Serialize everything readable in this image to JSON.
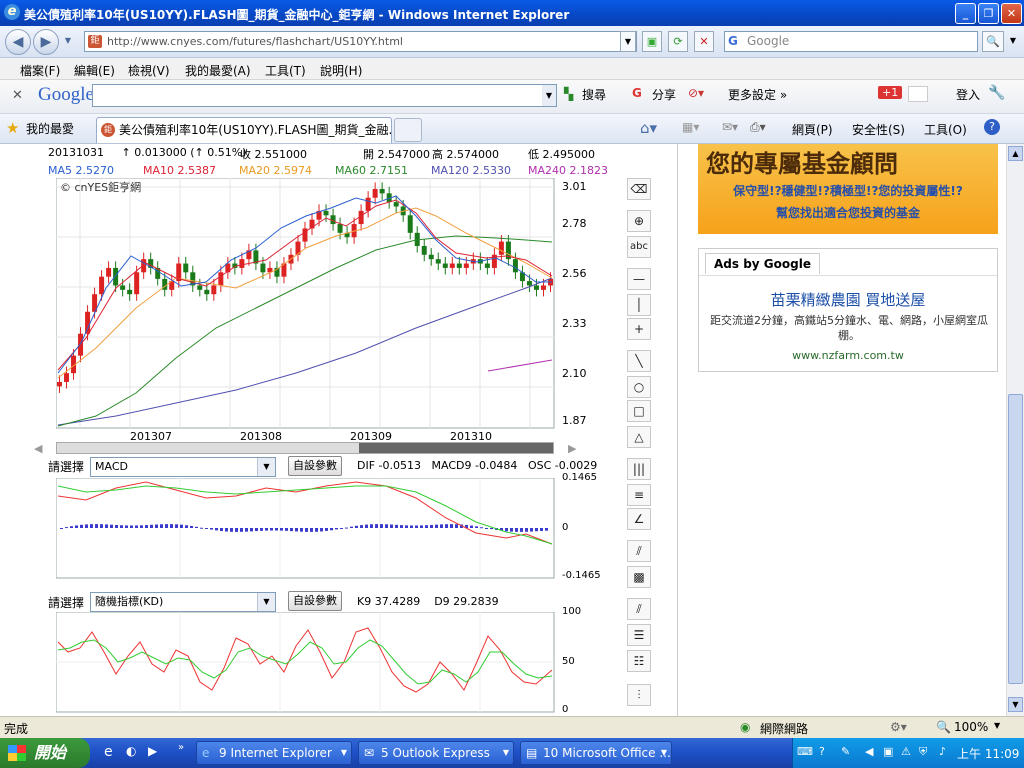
{
  "window": {
    "title": "美公債殖利率10年(US10YY).FLASH圖_期貨_金融中心_鉅亨網 - Windows Internet Explorer"
  },
  "address": {
    "url": "http://www.cnyes.com/futures/flashchart/US10YY.html",
    "search_placeholder": "Google"
  },
  "menu": [
    "檔案(F)",
    "編輯(E)",
    "檢視(V)",
    "我的最愛(A)",
    "工具(T)",
    "說明(H)"
  ],
  "google_toolbar": {
    "logo": "Google",
    "search_label": "搜尋",
    "share_label": "分享",
    "more_label": "更多設定 »",
    "gplus_label": "+1",
    "login_label": "登入"
  },
  "favorites": {
    "label": "我的最愛",
    "tab_title": "美公債殖利率10年(US10YY).FLASH圖_期貨_金融...",
    "page_label": "網頁(P)",
    "safety_label": "安全性(S)",
    "tools_label": "工具(O)"
  },
  "chart_info": {
    "date": "20131031",
    "change": "↑ 0.013000 (↑ 0.51%)",
    "close": "收 2.551000",
    "open": "開 2.547000",
    "high": "高 2.574000",
    "low": "低 2.495000",
    "ma5": "MA5 2.5270",
    "ma10": "MA10 2.5387",
    "ma20": "MA20 2.5974",
    "ma60": "MA60 2.7151",
    "ma120": "MA120 2.5330",
    "ma240": "MA240 2.1823",
    "watermark": "© cnYES鉅亨網"
  },
  "macd_panel": {
    "select_label": "請選擇",
    "selected": "MACD",
    "param_button": "自設參數",
    "dif": "DIF -0.0513",
    "macd9": "MACD9 -0.0484",
    "osc": "OSC -0.0029",
    "ymax": "0.1465",
    "yzero": "0",
    "ymin": "-0.1465"
  },
  "kd_panel": {
    "select_label": "請選擇",
    "selected": "隨機指標(KD)",
    "param_button": "自設參數",
    "k9": "K9 37.4289",
    "d9": "D9 29.2839",
    "y100": "100",
    "y50": "50",
    "y0": "0"
  },
  "chart_data": {
    "type": "candlestick",
    "x_labels": [
      "201307",
      "201308",
      "201309",
      "201310"
    ],
    "y_ticks": [
      3.01,
      2.78,
      2.56,
      2.33,
      2.1,
      1.87
    ],
    "ylim": [
      1.87,
      3.01
    ],
    "close": [
      2.08,
      2.12,
      2.2,
      2.3,
      2.4,
      2.48,
      2.56,
      2.6,
      2.52,
      2.5,
      2.48,
      2.58,
      2.64,
      2.6,
      2.55,
      2.5,
      2.54,
      2.62,
      2.58,
      2.52,
      2.5,
      2.48,
      2.52,
      2.58,
      2.62,
      2.6,
      2.64,
      2.68,
      2.62,
      2.58,
      2.6,
      2.56,
      2.62,
      2.66,
      2.72,
      2.78,
      2.82,
      2.86,
      2.84,
      2.8,
      2.76,
      2.74,
      2.8,
      2.86,
      2.92,
      2.96,
      2.94,
      2.9,
      2.88,
      2.84,
      2.76,
      2.7,
      2.66,
      2.64,
      2.62,
      2.6,
      2.62,
      2.6,
      2.62,
      2.64,
      2.62,
      2.6,
      2.66,
      2.72,
      2.64,
      2.58,
      2.54,
      2.52,
      2.5,
      2.52,
      2.55
    ],
    "ma_legend": [
      "MA5",
      "MA10",
      "MA20",
      "MA60",
      "MA120",
      "MA240"
    ]
  },
  "ads": {
    "banner_title": "您的專屬基金顧問",
    "banner_line1": "保守型!?穩健型!?積極型!?您的投資屬性!?",
    "banner_line2": "幫您找出適合您投資的基金",
    "ads_tab": "Ads by Google",
    "ad_title": "苗栗精緻農園 買地送屋",
    "ad_desc": "距交流道2分鐘，高鐵站5分鐘水、電、網路，小屋網室瓜棚。",
    "ad_url": "www.nzfarm.com.tw"
  },
  "status": {
    "text": "完成",
    "zone": "網際網路",
    "zoom": "100%"
  },
  "taskbar": {
    "start": "開始",
    "ie": "9 Internet Explorer",
    "outlook": "5 Outlook Express",
    "office": "10 Microsoft Office ...",
    "clock": "上午 11:09"
  }
}
